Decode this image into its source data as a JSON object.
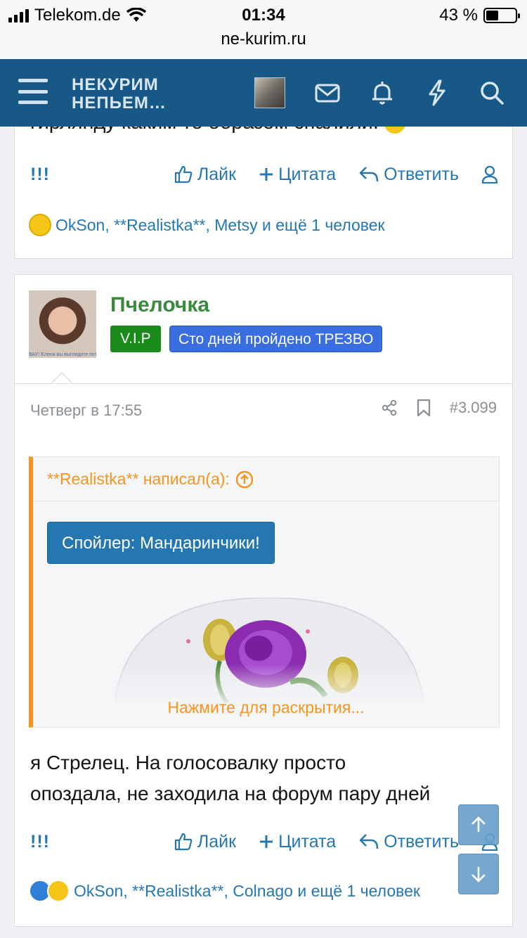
{
  "status_bar": {
    "carrier": "Telekom.de",
    "time": "01:34",
    "battery_text": "43 %",
    "battery_level": 0.43,
    "url": "ne-kurim.ru"
  },
  "nav": {
    "logo_line1": "НЕКУРИМ",
    "logo_line2": "НЕПЬЕМ…",
    "icons": [
      "menu-icon",
      "mail-icon",
      "bell-icon",
      "lightning-icon",
      "search-icon"
    ],
    "accent_color": "#185886"
  },
  "prev_post": {
    "partial_text": "гирлянду каким то образом спалили.",
    "actions": {
      "report": "!!!",
      "like": "Лайк",
      "quote": "Цитата",
      "reply": "Ответить"
    },
    "reactions": "OkSon, **Realistka**, Metsy и ещё 1 человек"
  },
  "post": {
    "username": "Пчелочка",
    "avatar_caption": "ВАУ! Елена вы выглядите потр",
    "badge_vip": "V.I.P",
    "badge_title": "Сто дней пройдено ТРЕЗВО",
    "date": "Четверг в 17:55",
    "number": "#3.099",
    "quote": {
      "author": "**Realistka** написал(а):",
      "spoiler_label": "Спойлер: Мандаринчики!",
      "expand_text": "Нажмите для раскрытия..."
    },
    "text_line1": "я Стрелец. На голосовалку просто",
    "text_line2": "опоздала, не заходила на форум пару дней",
    "actions": {
      "report": "!!!",
      "like": "Лайк",
      "quote": "Цитата",
      "reply": "Ответить"
    },
    "reactions": "OkSon, **Realistka**, Colnago и ещё 1 человек"
  },
  "colors": {
    "link": "#2577b1",
    "quote_accent": "#f7941d",
    "vip_badge": "#1a8a1a",
    "title_badge": "#3a6ee0",
    "username": "#3a8a3e"
  }
}
